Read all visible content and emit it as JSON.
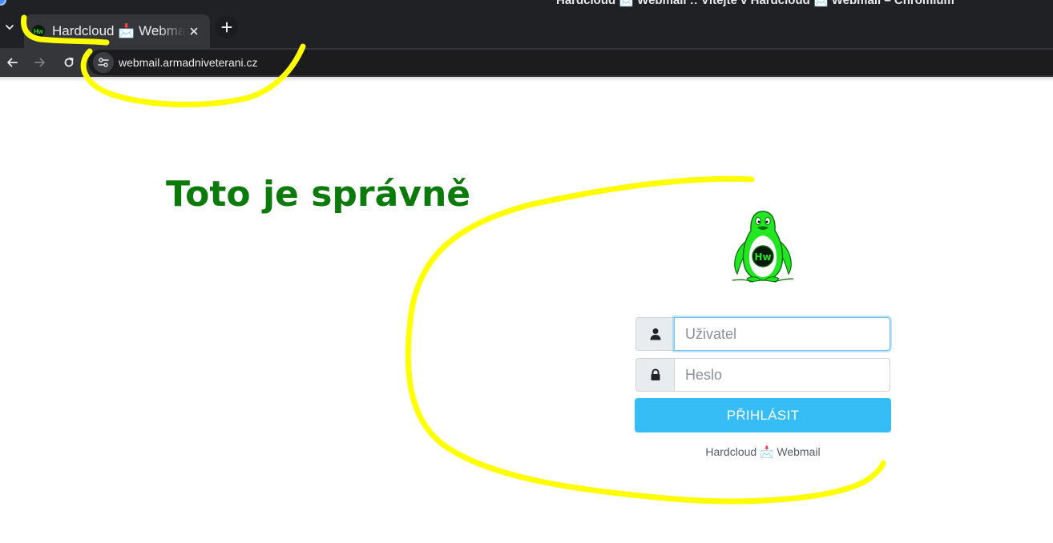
{
  "window": {
    "title": "Hardcloud 📩 Webmail :: Vítejte v Hardcloud 📩 Webmail – Chromium"
  },
  "tabs": [
    {
      "title": "Hardcloud 📩 Webmail :: Vítejte v Hardcloud 📩 Webmail",
      "favicon_text": "Hw",
      "active": true
    }
  ],
  "address_bar": {
    "url": "webmail.armadniveterani.cz"
  },
  "annotation": {
    "text": "Toto je správně",
    "color": "#0a7a0a",
    "scribble_color": "#ffff00"
  },
  "logo": {
    "text": "Hw",
    "body_color": "#22e622",
    "badge_text_color": "#22e622"
  },
  "login_form": {
    "username_placeholder": "Uživatel",
    "password_placeholder": "Heslo",
    "submit_label": "PŘIHLÁSIT",
    "submit_color": "#37bdf6"
  },
  "footer": {
    "text": "Hardcloud 📩 Webmail"
  },
  "icons": {
    "tab_menu": "chevron-down-icon",
    "tab_close": "close-icon",
    "new_tab": "plus-icon",
    "back": "back-arrow-icon",
    "forward": "forward-arrow-icon",
    "reload": "reload-icon",
    "site_info": "tune-icon",
    "username": "user-icon",
    "password": "lock-icon"
  }
}
